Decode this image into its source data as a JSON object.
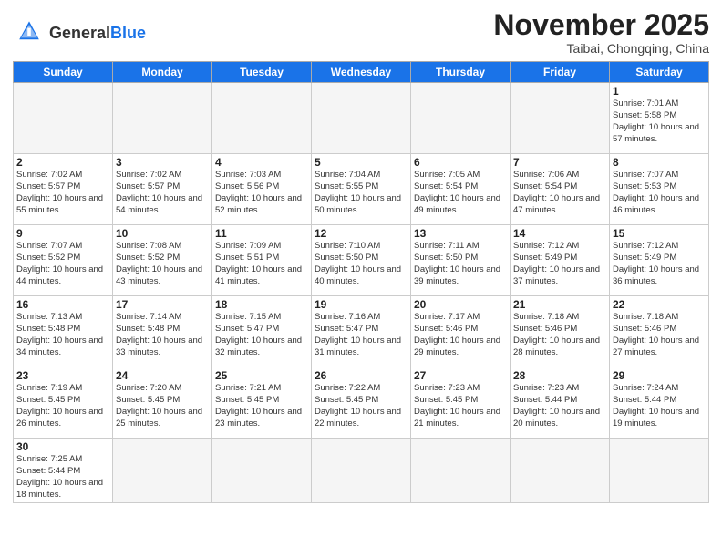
{
  "header": {
    "logo_general": "General",
    "logo_blue": "Blue",
    "month_title": "November 2025",
    "subtitle": "Taibai, Chongqing, China"
  },
  "weekdays": [
    "Sunday",
    "Monday",
    "Tuesday",
    "Wednesday",
    "Thursday",
    "Friday",
    "Saturday"
  ],
  "days": [
    {
      "num": "1",
      "sunrise": "7:01 AM",
      "sunset": "5:58 PM",
      "daylight": "10 hours and 57 minutes."
    },
    {
      "num": "2",
      "sunrise": "7:02 AM",
      "sunset": "5:57 PM",
      "daylight": "10 hours and 55 minutes."
    },
    {
      "num": "3",
      "sunrise": "7:02 AM",
      "sunset": "5:57 PM",
      "daylight": "10 hours and 54 minutes."
    },
    {
      "num": "4",
      "sunrise": "7:03 AM",
      "sunset": "5:56 PM",
      "daylight": "10 hours and 52 minutes."
    },
    {
      "num": "5",
      "sunrise": "7:04 AM",
      "sunset": "5:55 PM",
      "daylight": "10 hours and 50 minutes."
    },
    {
      "num": "6",
      "sunrise": "7:05 AM",
      "sunset": "5:54 PM",
      "daylight": "10 hours and 49 minutes."
    },
    {
      "num": "7",
      "sunrise": "7:06 AM",
      "sunset": "5:54 PM",
      "daylight": "10 hours and 47 minutes."
    },
    {
      "num": "8",
      "sunrise": "7:07 AM",
      "sunset": "5:53 PM",
      "daylight": "10 hours and 46 minutes."
    },
    {
      "num": "9",
      "sunrise": "7:07 AM",
      "sunset": "5:52 PM",
      "daylight": "10 hours and 44 minutes."
    },
    {
      "num": "10",
      "sunrise": "7:08 AM",
      "sunset": "5:52 PM",
      "daylight": "10 hours and 43 minutes."
    },
    {
      "num": "11",
      "sunrise": "7:09 AM",
      "sunset": "5:51 PM",
      "daylight": "10 hours and 41 minutes."
    },
    {
      "num": "12",
      "sunrise": "7:10 AM",
      "sunset": "5:50 PM",
      "daylight": "10 hours and 40 minutes."
    },
    {
      "num": "13",
      "sunrise": "7:11 AM",
      "sunset": "5:50 PM",
      "daylight": "10 hours and 39 minutes."
    },
    {
      "num": "14",
      "sunrise": "7:12 AM",
      "sunset": "5:49 PM",
      "daylight": "10 hours and 37 minutes."
    },
    {
      "num": "15",
      "sunrise": "7:12 AM",
      "sunset": "5:49 PM",
      "daylight": "10 hours and 36 minutes."
    },
    {
      "num": "16",
      "sunrise": "7:13 AM",
      "sunset": "5:48 PM",
      "daylight": "10 hours and 34 minutes."
    },
    {
      "num": "17",
      "sunrise": "7:14 AM",
      "sunset": "5:48 PM",
      "daylight": "10 hours and 33 minutes."
    },
    {
      "num": "18",
      "sunrise": "7:15 AM",
      "sunset": "5:47 PM",
      "daylight": "10 hours and 32 minutes."
    },
    {
      "num": "19",
      "sunrise": "7:16 AM",
      "sunset": "5:47 PM",
      "daylight": "10 hours and 31 minutes."
    },
    {
      "num": "20",
      "sunrise": "7:17 AM",
      "sunset": "5:46 PM",
      "daylight": "10 hours and 29 minutes."
    },
    {
      "num": "21",
      "sunrise": "7:18 AM",
      "sunset": "5:46 PM",
      "daylight": "10 hours and 28 minutes."
    },
    {
      "num": "22",
      "sunrise": "7:18 AM",
      "sunset": "5:46 PM",
      "daylight": "10 hours and 27 minutes."
    },
    {
      "num": "23",
      "sunrise": "7:19 AM",
      "sunset": "5:45 PM",
      "daylight": "10 hours and 26 minutes."
    },
    {
      "num": "24",
      "sunrise": "7:20 AM",
      "sunset": "5:45 PM",
      "daylight": "10 hours and 25 minutes."
    },
    {
      "num": "25",
      "sunrise": "7:21 AM",
      "sunset": "5:45 PM",
      "daylight": "10 hours and 23 minutes."
    },
    {
      "num": "26",
      "sunrise": "7:22 AM",
      "sunset": "5:45 PM",
      "daylight": "10 hours and 22 minutes."
    },
    {
      "num": "27",
      "sunrise": "7:23 AM",
      "sunset": "5:45 PM",
      "daylight": "10 hours and 21 minutes."
    },
    {
      "num": "28",
      "sunrise": "7:23 AM",
      "sunset": "5:44 PM",
      "daylight": "10 hours and 20 minutes."
    },
    {
      "num": "29",
      "sunrise": "7:24 AM",
      "sunset": "5:44 PM",
      "daylight": "10 hours and 19 minutes."
    },
    {
      "num": "30",
      "sunrise": "7:25 AM",
      "sunset": "5:44 PM",
      "daylight": "10 hours and 18 minutes."
    }
  ]
}
